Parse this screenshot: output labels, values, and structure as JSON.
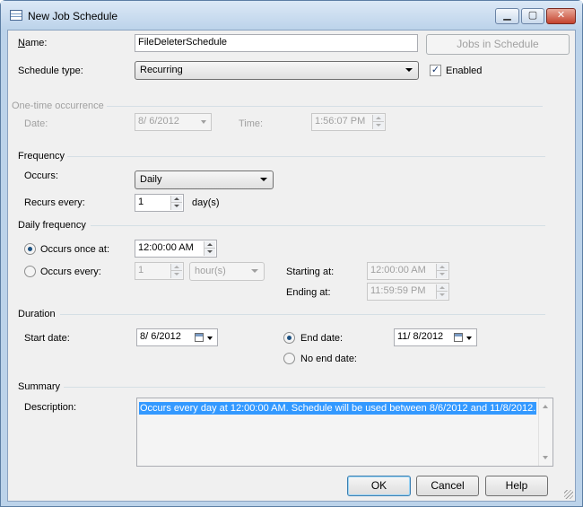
{
  "window": {
    "title": "New Job Schedule"
  },
  "name": {
    "label": "Name:",
    "value": "FileDeleterSchedule",
    "jobs_button": "Jobs in Schedule"
  },
  "schedule_type": {
    "label": "Schedule type:",
    "value": "Recurring",
    "enabled_label": "Enabled",
    "enabled": true
  },
  "one_time": {
    "group": "One-time occurrence",
    "date_label": "Date:",
    "date_value": "8/ 6/2012",
    "time_label": "Time:",
    "time_value": "1:56:07 PM"
  },
  "frequency": {
    "group": "Frequency",
    "occurs_label": "Occurs:",
    "occurs_value": "Daily",
    "recurs_label": "Recurs every:",
    "recurs_value": "1",
    "recurs_unit": "day(s)"
  },
  "daily_frequency": {
    "group": "Daily frequency",
    "once_label": "Occurs once at:",
    "once_value": "12:00:00 AM",
    "once_selected": true,
    "every_label": "Occurs every:",
    "every_value": "1",
    "every_unit": "hour(s)",
    "starting_label": "Starting at:",
    "starting_value": "12:00:00 AM",
    "ending_label": "Ending at:",
    "ending_value": "11:59:59 PM"
  },
  "duration": {
    "group": "Duration",
    "start_label": "Start date:",
    "start_value": "8/ 6/2012",
    "end_label": "End date:",
    "end_value": "11/ 8/2012",
    "end_selected": true,
    "no_end_label": "No end date:"
  },
  "summary": {
    "group": "Summary",
    "description_label": "Description:",
    "description": "Occurs every day at 12:00:00 AM. Schedule will be used between 8/6/2012 and 11/8/2012."
  },
  "buttons": {
    "ok": "OK",
    "cancel": "Cancel",
    "help": "Help"
  },
  "colors": {
    "selection": "#3399ff",
    "frame": "#bcd3ea",
    "close": "#c4432e"
  }
}
